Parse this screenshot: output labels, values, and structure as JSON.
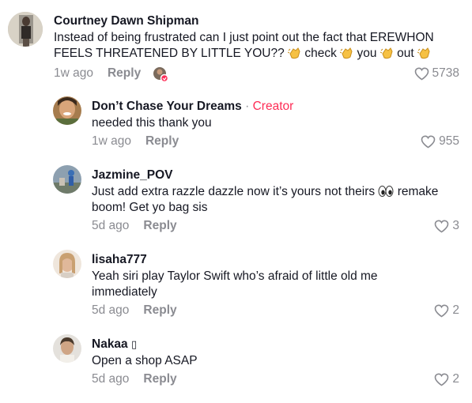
{
  "comments": [
    {
      "username": "Courtney Dawn Shipman",
      "text_parts": [
        "Instead of being frustrated can I just point out the fact that EREWHON FEELS THREATENED BY LITTLE YOU??",
        "check",
        "you",
        "out"
      ],
      "time": "1w ago",
      "reply_label": "Reply",
      "likes": "5738",
      "avatar_icon": "profile-photo",
      "emoji_icon": "clapping-hands-icon"
    },
    {
      "username": "Don’t Chase Your Dreams",
      "separator": "·",
      "creator_label": "Creator",
      "text": "needed this thank you",
      "time": "1w ago",
      "reply_label": "Reply",
      "likes": "955",
      "avatar_icon": "profile-photo"
    },
    {
      "username": "Jazmine_POV",
      "text_parts": [
        "Just add extra razzle dazzle now it’s yours not theirs",
        "remake boom! Get yo bag sis"
      ],
      "time": "5d ago",
      "reply_label": "Reply",
      "likes": "3",
      "avatar_icon": "profile-photo",
      "emoji_icon": "eyes-icon"
    },
    {
      "username": "lisaha777",
      "text": "Yeah siri play Taylor Swift who’s afraid of little old me immediately",
      "time": "5d ago",
      "reply_label": "Reply",
      "likes": "2",
      "avatar_icon": "profile-photo"
    },
    {
      "username": "Nakaa",
      "username_glyph": "▯",
      "text": "Open a shop ASAP",
      "time": "5d ago",
      "reply_label": "Reply",
      "likes": "2",
      "avatar_icon": "profile-photo"
    }
  ],
  "colors": {
    "text_primary": "#161823",
    "text_secondary": "#8a8b91",
    "creator_accent": "#fe2c55",
    "background": "#ffffff"
  }
}
